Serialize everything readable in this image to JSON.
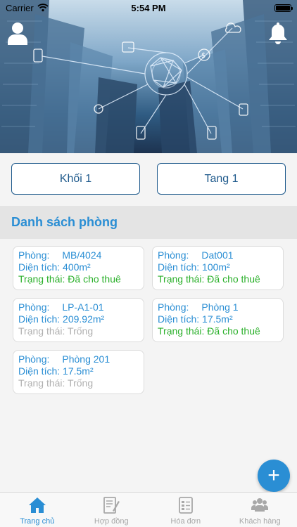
{
  "status_bar": {
    "carrier": "Carrier",
    "time": "5:54 PM"
  },
  "selectors": {
    "block": "Khối 1",
    "floor": "Tang 1"
  },
  "section": {
    "title": "Danh sách phòng"
  },
  "labels": {
    "room": "Phòng:",
    "area": "Diện tích:",
    "status": "Trạng thái:"
  },
  "rooms": [
    {
      "name": "MB/4024",
      "area": "400m²",
      "status": "Đã cho thuê",
      "status_color": "#2bb02b"
    },
    {
      "name": "Dat001",
      "area": "100m²",
      "status": "Đã cho thuê",
      "status_color": "#2bb02b"
    },
    {
      "name": "LP-A1-01",
      "area": "209.92m²",
      "status": "Trống",
      "status_color": "#b0b0b0"
    },
    {
      "name": "Phòng 1",
      "area": "17.5m²",
      "status": "Đã cho thuê",
      "status_color": "#2bb02b"
    },
    {
      "name": "Phòng 201",
      "area": "17.5m²",
      "status": "Trống",
      "status_color": "#b0b0b0"
    }
  ],
  "fab": {
    "label": "+"
  },
  "tabs": [
    {
      "label": "Trang chủ",
      "icon": "home-icon",
      "active": true
    },
    {
      "label": "Hợp đồng",
      "icon": "contract-icon",
      "active": false
    },
    {
      "label": "Hóa đơn",
      "icon": "invoice-icon",
      "active": false
    },
    {
      "label": "Khách hàng",
      "icon": "customers-icon",
      "active": false
    }
  ],
  "colors": {
    "accent": "#2a8ed4",
    "selector_border": "#1f5a8c",
    "rented": "#2bb02b",
    "vacant": "#b0b0b0"
  }
}
